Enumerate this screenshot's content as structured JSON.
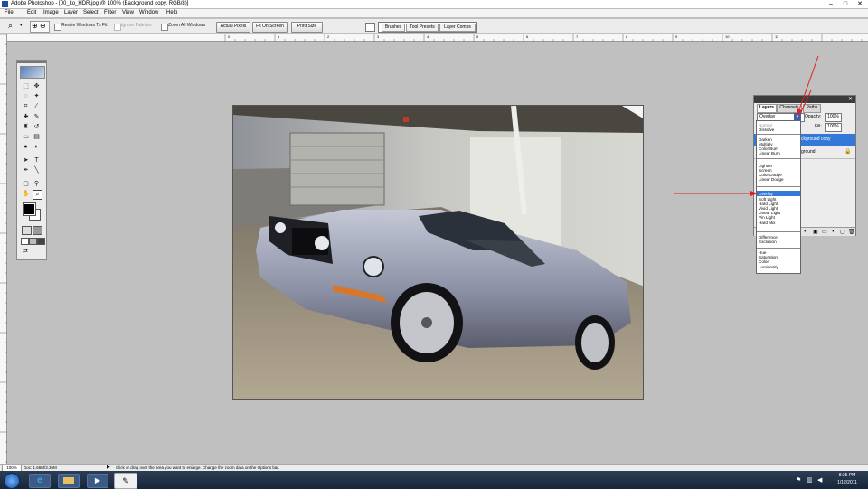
{
  "window": {
    "title": "Adobe Photoshop - [00_ko_HDR.jpg @ 100% (Background copy, RGB/8)]",
    "minimize": "–",
    "maximize": "□",
    "close": "✕"
  },
  "menu": [
    "File",
    "Edit",
    "Image",
    "Layer",
    "Select",
    "Filter",
    "View",
    "Window",
    "Help"
  ],
  "options": {
    "resize_windows": "Resize Windows To Fit",
    "ignore_palettes": "Ignore Palettes",
    "zoom_all": "Zoom All Windows",
    "actual_pixels": "Actual Pixels",
    "fit_on_screen": "Fit On Screen",
    "print_size": "Print Size",
    "dock_tabs": [
      "Brushes",
      "Tool Presets",
      "Layer Comps"
    ]
  },
  "ruler_top": [
    "0",
    "1",
    "2",
    "3",
    "4",
    "5",
    "6",
    "7",
    "8",
    "9",
    "10",
    "11"
  ],
  "layers_panel": {
    "tabs": [
      "Layers",
      "Channels",
      "Paths"
    ],
    "blend_mode": "Overlay",
    "opacity_label": "Opacity:",
    "opacity": "100%",
    "fill_label": "Fill:",
    "fill": "100%",
    "layer_rows": [
      "ckground copy",
      "ground"
    ]
  },
  "blend_modes": [
    [
      "Normal",
      "Dissolve"
    ],
    [
      "Darken",
      "Multiply",
      "Color Burn",
      "Linear Burn"
    ],
    [
      "Lighten",
      "Screen",
      "Color Dodge",
      "Linear Dodge"
    ],
    [
      "Overlay",
      "Soft Light",
      "Hard Light",
      "Vivid Light",
      "Linear Light",
      "Pin Light",
      "Hard Mix"
    ],
    [
      "Difference",
      "Exclusion"
    ],
    [
      "Hue",
      "Saturation",
      "Color",
      "Luminosity"
    ]
  ],
  "selected_blend": "Overlay",
  "status": {
    "zoom": "100%",
    "doc": "Doc: 1.66M/3.36M",
    "hint": "Click or drag over the area you want to enlarge. Change the zoom data on the Options bar."
  },
  "taskbar": {
    "time": "8:35 PM",
    "date": "1/12/2011"
  },
  "colors": {
    "accent": "#3478d8",
    "annotation_red": "#e02020",
    "workspace": "#c0c0c0"
  }
}
